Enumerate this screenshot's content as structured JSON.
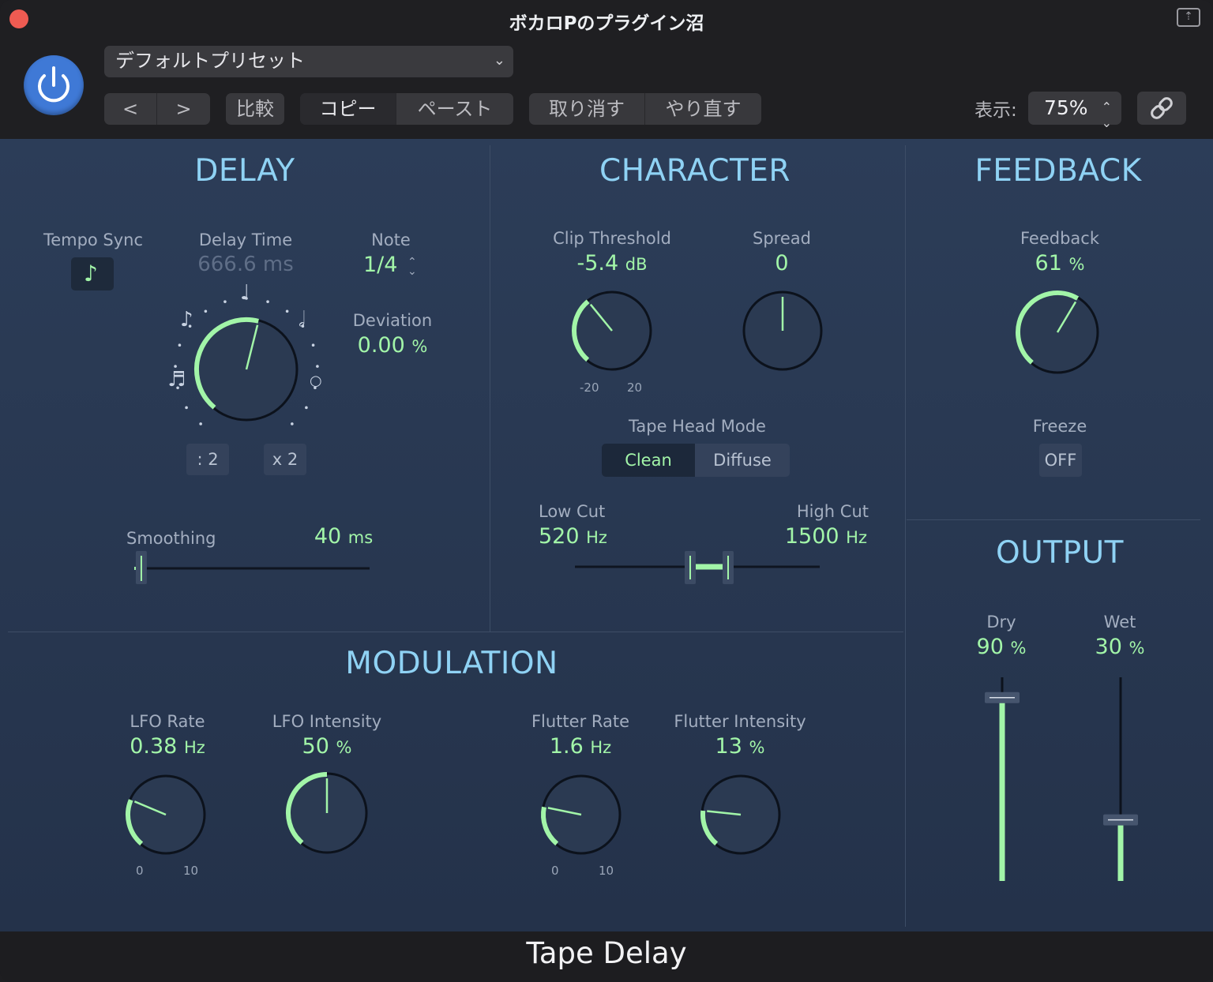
{
  "window": {
    "title": "ボカロPのプラグイン沼"
  },
  "header": {
    "preset": "デフォルトプリセット",
    "prev": "<",
    "next": ">",
    "compare": "比較",
    "copy": "コピー",
    "paste": "ペースト",
    "undo": "取り消す",
    "redo": "やり直す",
    "view_label": "表示:",
    "zoom": "75%"
  },
  "delay": {
    "title": "DELAY",
    "tempo_sync_label": "Tempo Sync",
    "delay_time_label": "Delay Time",
    "delay_time_value": "666.6 ms",
    "delay_time_fraction": 0.55,
    "note_label": "Note",
    "note_value": "1/4",
    "deviation_label": "Deviation",
    "deviation_value": "0.00",
    "deviation_unit": "%",
    "half_button": ": 2",
    "double_button": "x 2",
    "smoothing_label": "Smoothing",
    "smoothing_value": "40",
    "smoothing_unit": "ms",
    "smoothing_fraction": 0.03
  },
  "character": {
    "title": "CHARACTER",
    "clip_label": "Clip Threshold",
    "clip_value": "-5.4",
    "clip_unit": "dB",
    "clip_fraction": 0.36,
    "clip_min": "-20",
    "clip_max": "20",
    "spread_label": "Spread",
    "spread_value": "0",
    "spread_fraction": 0.5,
    "tape_head_label": "Tape Head Mode",
    "mode_clean": "Clean",
    "mode_diffuse": "Diffuse",
    "low_cut_label": "Low Cut",
    "low_cut_value": "520",
    "low_cut_unit": "Hz",
    "high_cut_label": "High Cut",
    "high_cut_value": "1500",
    "high_cut_unit": "Hz"
  },
  "feedback": {
    "title": "FEEDBACK",
    "feedback_label": "Feedback",
    "feedback_value": "61",
    "feedback_unit": "%",
    "feedback_fraction": 0.61,
    "freeze_label": "Freeze",
    "freeze_value": "OFF"
  },
  "output": {
    "title": "OUTPUT",
    "dry_label": "Dry",
    "dry_value": "90",
    "dry_unit": "%",
    "dry_fraction": 0.9,
    "wet_label": "Wet",
    "wet_value": "30",
    "wet_unit": "%",
    "wet_fraction": 0.3
  },
  "modulation": {
    "title": "MODULATION",
    "lfo_rate_label": "LFO Rate",
    "lfo_rate_value": "0.38",
    "lfo_rate_unit": "Hz",
    "lfo_rate_fraction": 0.26,
    "lfo_rate_min": "0",
    "lfo_rate_max": "10",
    "lfo_int_label": "LFO Intensity",
    "lfo_int_value": "50",
    "lfo_int_unit": "%",
    "lfo_int_fraction": 0.5,
    "flutter_rate_label": "Flutter Rate",
    "flutter_rate_value": "1.6",
    "flutter_rate_unit": "Hz",
    "flutter_rate_fraction": 0.22,
    "flutter_rate_min": "0",
    "flutter_rate_max": "10",
    "flutter_int_label": "Flutter Intensity",
    "flutter_int_value": "13",
    "flutter_int_unit": "%",
    "flutter_int_fraction": 0.2
  },
  "footer": {
    "plugin_name": "Tape Delay"
  },
  "colors": {
    "accent": "#a2f5a8",
    "title": "#8fd2f4",
    "power": "#3f79d6"
  }
}
